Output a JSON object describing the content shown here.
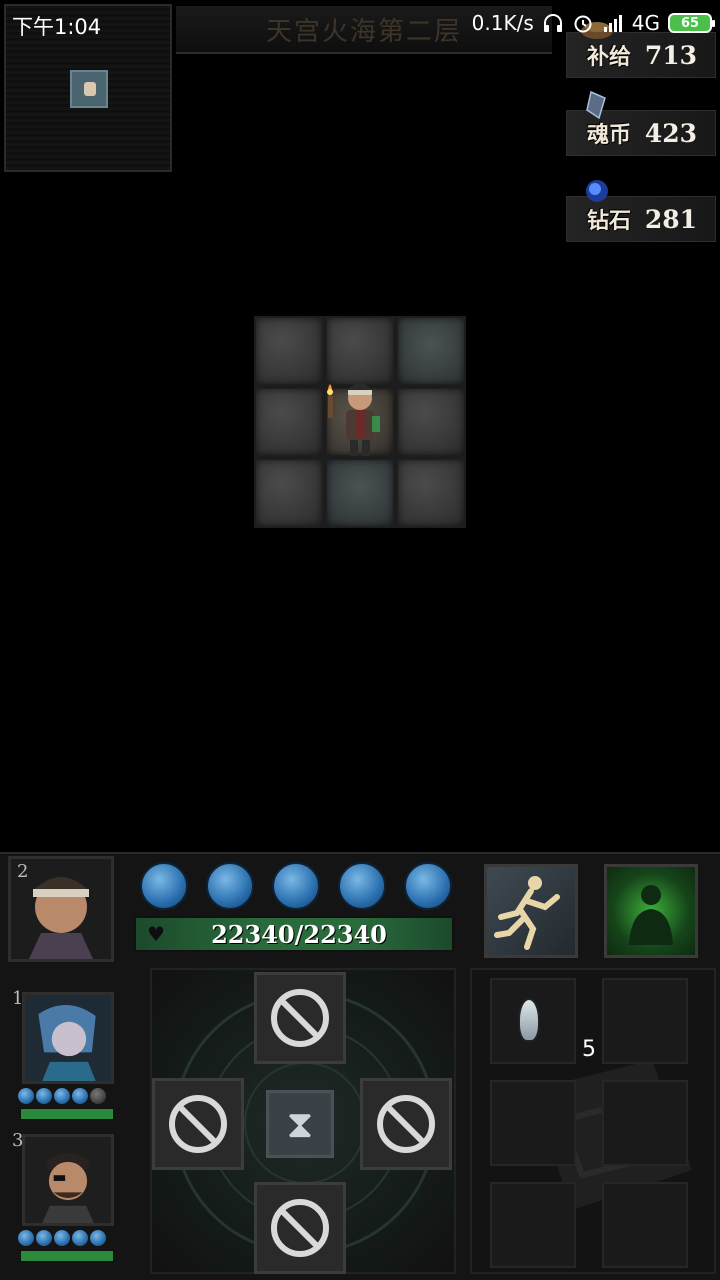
{
  "status_bar": {
    "time": "下午1:04",
    "net_speed": "0.1K/s",
    "network": "4G",
    "battery": "65"
  },
  "level": {
    "title": "天宫火海第二层"
  },
  "resources": [
    {
      "label": "补给",
      "value": "713",
      "icon": "supply-icon"
    },
    {
      "label": "魂币",
      "value": "423",
      "icon": "soul-coin-icon"
    },
    {
      "label": "钻石",
      "value": "281",
      "icon": "diamond-icon"
    }
  ],
  "leader": {
    "slot": "2",
    "hp": "22340/22340",
    "energy_orbs": 5,
    "skills": [
      "flee-icon",
      "pray-icon"
    ]
  },
  "party": [
    {
      "slot": "1",
      "energy": [
        1,
        1,
        1,
        1,
        0
      ]
    },
    {
      "slot": "3",
      "energy": [
        1,
        1,
        1,
        1,
        1
      ]
    }
  ],
  "inventory": {
    "item_count": "5"
  },
  "colors": {
    "hp_green": "#2a6b3c",
    "orb_blue": "#2a6fae"
  }
}
